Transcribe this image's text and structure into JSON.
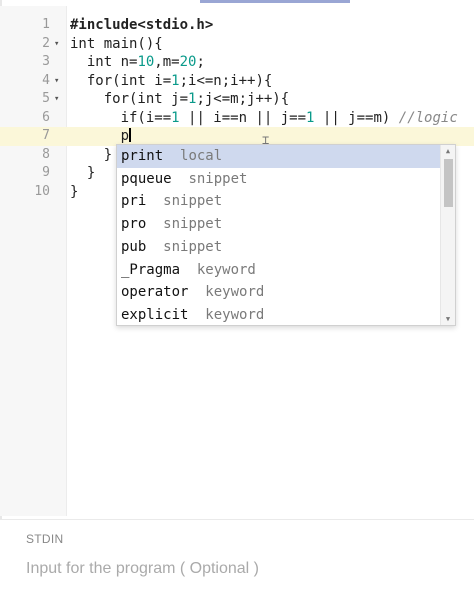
{
  "editor": {
    "lines": [
      {
        "n": "1",
        "fold": "",
        "text": "#include<stdio.h>"
      },
      {
        "n": "2",
        "fold": "▾",
        "text": "int main(){"
      },
      {
        "n": "3",
        "fold": "",
        "text": "  int n=10,m=20;"
      },
      {
        "n": "4",
        "fold": "▾",
        "text": "  for(int i=1;i<=n;i++){"
      },
      {
        "n": "5",
        "fold": "▾",
        "text": "    for(int j=1;j<=m;j++){"
      },
      {
        "n": "6",
        "fold": "",
        "text": "      if(i==1 || i==n || j==1 || j==m) //logic"
      },
      {
        "n": "7",
        "fold": "",
        "text": "      p"
      },
      {
        "n": "8",
        "fold": "",
        "text": "    }"
      },
      {
        "n": "9",
        "fold": "",
        "text": "  }"
      },
      {
        "n": "10",
        "fold": "",
        "text": "}"
      }
    ],
    "active_line": "7"
  },
  "autocomplete": {
    "items": [
      {
        "name": "print",
        "kind": "local",
        "selected": true
      },
      {
        "name": "pqueue",
        "kind": "snippet"
      },
      {
        "name": "pri",
        "kind": "snippet"
      },
      {
        "name": "pro",
        "kind": "snippet"
      },
      {
        "name": "pub",
        "kind": "snippet"
      },
      {
        "name": "_Pragma",
        "kind": "keyword"
      },
      {
        "name": "operator",
        "kind": "keyword"
      },
      {
        "name": "explicit",
        "kind": "keyword"
      }
    ]
  },
  "stdin": {
    "label": "STDIN",
    "placeholder": "Input for the program ( Optional )",
    "value": ""
  }
}
